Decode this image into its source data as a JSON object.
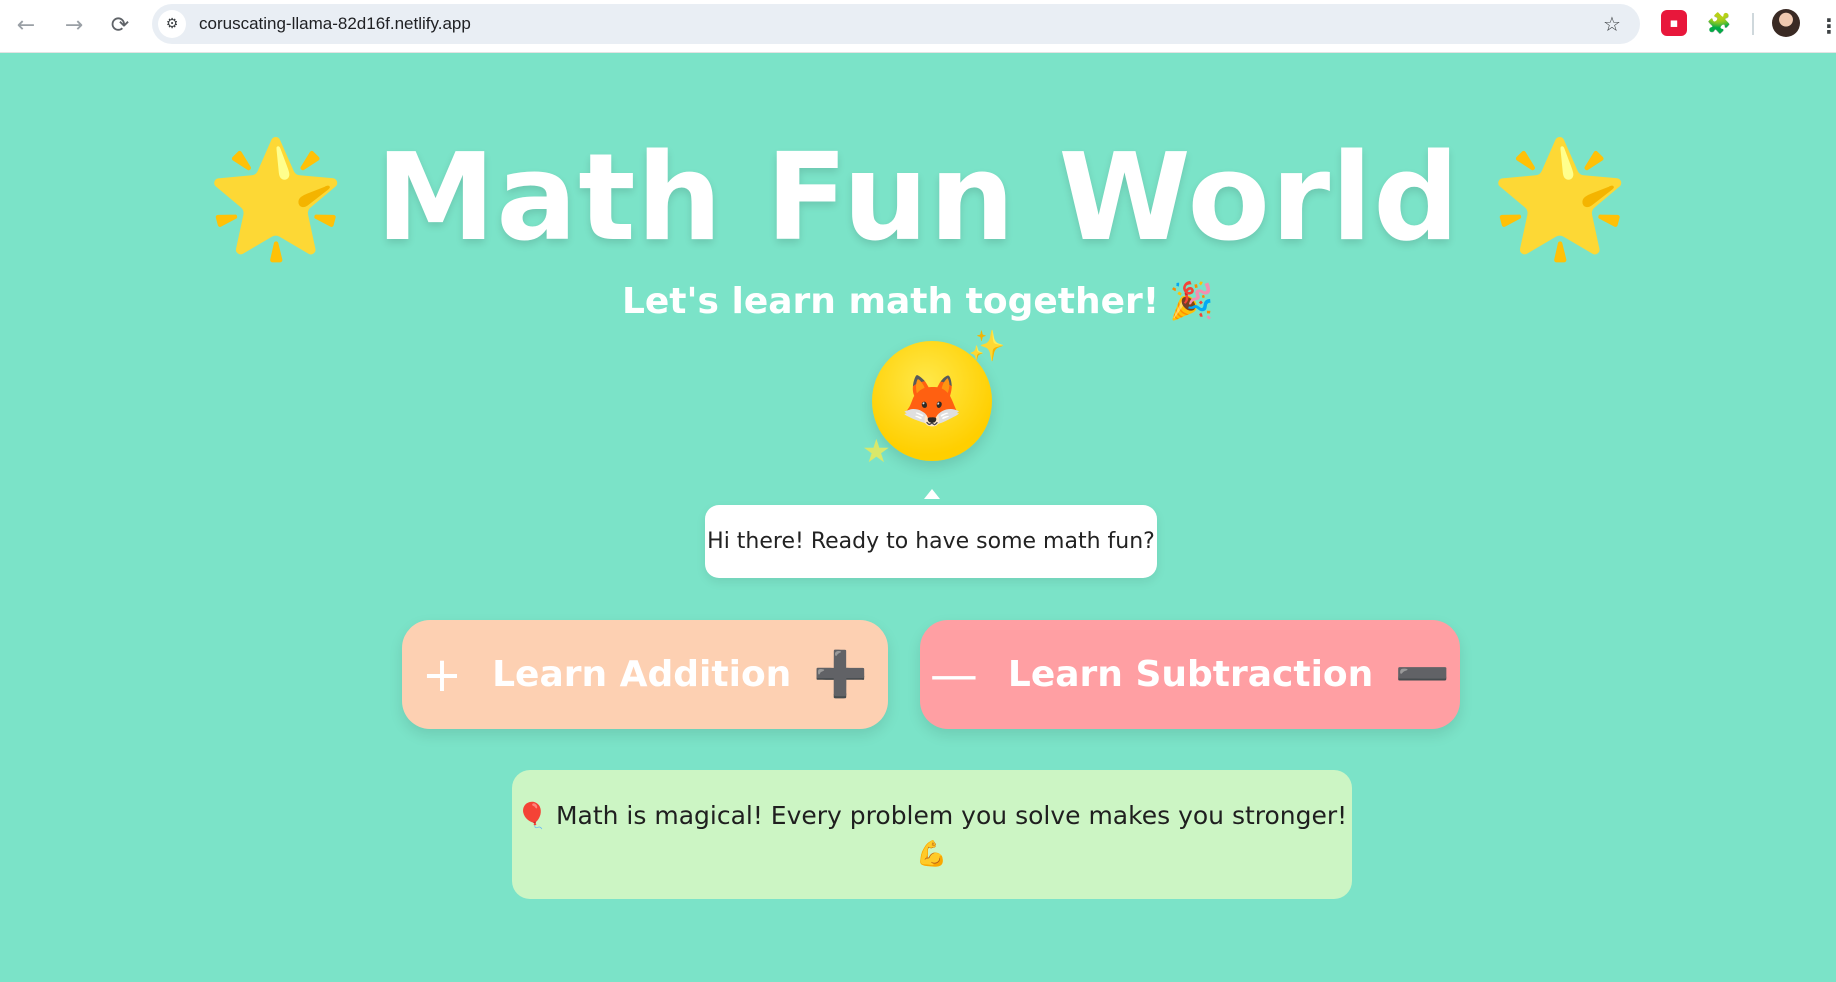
{
  "browser": {
    "url": "coruscating-llama-82d16f.netlify.app",
    "back_icon": "←",
    "forward_icon": "→",
    "reload_icon": "⟳",
    "site_info_icon": "⚙",
    "bookmark_icon": "☆",
    "extension_icon": "🧩",
    "menu_icon": "⋮",
    "icons": [
      "back-arrow-icon",
      "forward-arrow-icon",
      "reload-icon",
      "site-info-icon",
      "bookmark-star-icon",
      "extension-icon",
      "puzzle-icon",
      "avatar",
      "menu-dots-icon"
    ]
  },
  "page": {
    "title": "Math Fun World",
    "title_star_left": "🌟",
    "title_star_right": "🌟",
    "subtitle": "Let's learn math together!",
    "subtitle_emoji": "🎉",
    "mascot_emoji": "🦊",
    "sparkle_emoji": "✨",
    "small_star": "★",
    "speech": "Hi there! Ready to have some math fun?",
    "buttons": {
      "addition": {
        "icon": "+",
        "label": "Learn Addition",
        "emoji": "➕"
      },
      "subtraction": {
        "icon": "—",
        "label": "Learn Subtraction",
        "emoji": "➖"
      }
    },
    "motivation": {
      "balloon": "🎈",
      "text": "Math is magical! Every problem you solve makes you stronger!",
      "emoji": "💪"
    }
  },
  "colors": {
    "background": "#7be3c8",
    "addition_button": "#fdd0b2",
    "subtraction_button": "#ff9fa3",
    "motivation_box": "#ccf5c4",
    "mascot": "#ffd700"
  }
}
